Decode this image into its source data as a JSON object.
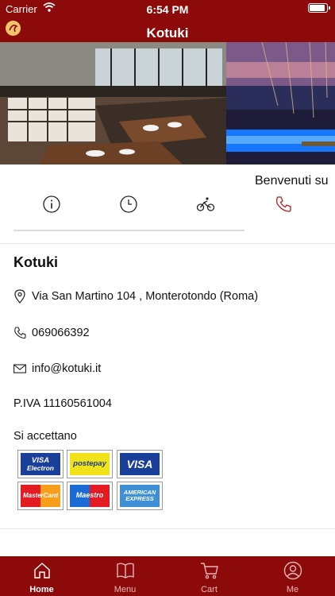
{
  "status": {
    "carrier": "Carrier",
    "time": "6:54 PM"
  },
  "header": {
    "title": "Kotuki"
  },
  "welcome": "Benvenuti su",
  "restaurant": {
    "name": "Kotuki",
    "address": "Via San Martino 104 , Monterotondo (Roma)",
    "phone": "069066392",
    "email": "info@kotuki.it",
    "piva": "P.IVA 11160561004",
    "accept_label": "Si accettano"
  },
  "payment_cards": [
    {
      "name": "VISA Electron",
      "line1": "VISA",
      "line2": "Electron"
    },
    {
      "name": "postepay",
      "line1": "postepay",
      "line2": ""
    },
    {
      "name": "VISA",
      "line1": "VISA",
      "line2": ""
    },
    {
      "name": "MasterCard",
      "line1": "MasterCard",
      "line2": ""
    },
    {
      "name": "Maestro",
      "line1": "Maestro",
      "line2": ""
    },
    {
      "name": "American Express",
      "line1": "AMERICAN",
      "line2": "EXPRESS"
    }
  ],
  "tabs": [
    {
      "label": "Home",
      "icon": "home-icon",
      "active": true
    },
    {
      "label": "Menu",
      "icon": "book-icon",
      "active": false
    },
    {
      "label": "Cart",
      "icon": "cart-icon",
      "active": false
    },
    {
      "label": "Me",
      "icon": "user-icon",
      "active": false
    }
  ],
  "colors": {
    "brand": "#8d0a0a",
    "phone_accent": "#b22222"
  }
}
